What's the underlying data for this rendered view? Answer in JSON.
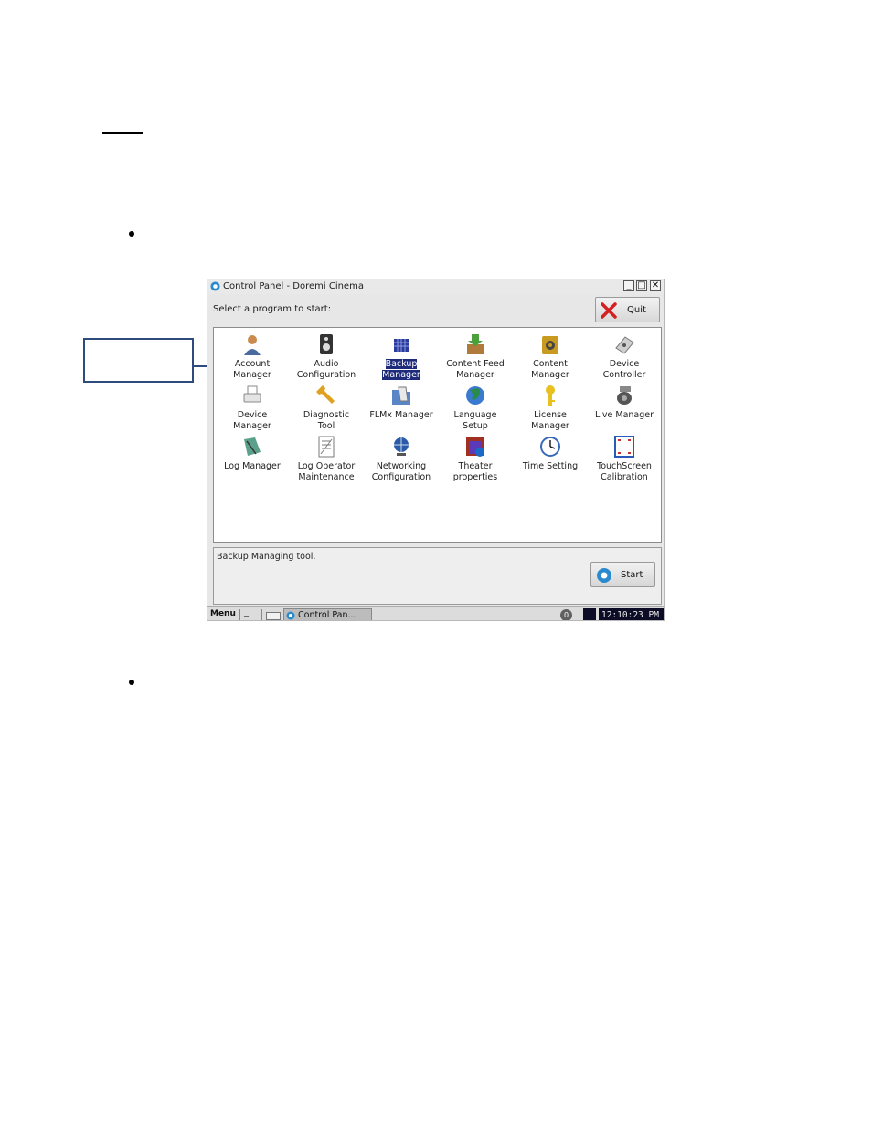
{
  "window": {
    "title": "Control Panel - Doremi Cinema",
    "prompt": "Select a program to start:",
    "quit_label": "Quit",
    "description": "Backup Managing tool.",
    "start_label": "Start"
  },
  "apps": [
    {
      "line1": "Account",
      "line2": "Manager",
      "icon": "user-icon",
      "color": "#c98c4e"
    },
    {
      "line1": "Audio",
      "line2": "Configuration",
      "icon": "speaker-icon",
      "color": "#333333"
    },
    {
      "line1": "Backup",
      "line2": "Manager",
      "icon": "backup-icon",
      "color": "#2a3a9a",
      "selected": true
    },
    {
      "line1": "Content Feed",
      "line2": "Manager",
      "icon": "download-box-icon",
      "color": "#4aa03a"
    },
    {
      "line1": "Content",
      "line2": "Manager",
      "icon": "film-reel-icon",
      "color": "#c89a20"
    },
    {
      "line1": "Device",
      "line2": "Controller",
      "icon": "device-icon",
      "color": "#7a7a7a"
    },
    {
      "line1": "Device",
      "line2": "Manager",
      "icon": "printer-icon",
      "color": "#8a8a8a"
    },
    {
      "line1": "Diagnostic",
      "line2": "Tool",
      "icon": "wrench-icon",
      "color": "#e0a020"
    },
    {
      "line1": "FLMx Manager",
      "line2": "",
      "icon": "folder-icon",
      "color": "#5a86c8"
    },
    {
      "line1": "Language",
      "line2": "Setup",
      "icon": "globe-icon",
      "color": "#2a8a4a"
    },
    {
      "line1": "License",
      "line2": "Manager",
      "icon": "key-icon",
      "color": "#e8c020"
    },
    {
      "line1": "Live Manager",
      "line2": "",
      "icon": "camera-icon",
      "color": "#555555"
    },
    {
      "line1": "Log Manager",
      "line2": "",
      "icon": "log-icon",
      "color": "#5aa08a"
    },
    {
      "line1": "Log Operator",
      "line2": "Maintenance",
      "icon": "document-icon",
      "color": "#7a7a7a"
    },
    {
      "line1": "Networking",
      "line2": "Configuration",
      "icon": "network-globe-icon",
      "color": "#2a5aa8"
    },
    {
      "line1": "Theater",
      "line2": "properties",
      "icon": "theater-icon",
      "color": "#a03020"
    },
    {
      "line1": "Time Setting",
      "line2": "",
      "icon": "clock-icon",
      "color": "#3a6ab8"
    },
    {
      "line1": "TouchScreen",
      "line2": "Calibration",
      "icon": "target-icon",
      "color": "#c83030"
    }
  ],
  "taskbar": {
    "menu_label": "Menu",
    "task_label": "Control Pan...",
    "notify_count": "0",
    "clock": "12:10:23 PM"
  }
}
